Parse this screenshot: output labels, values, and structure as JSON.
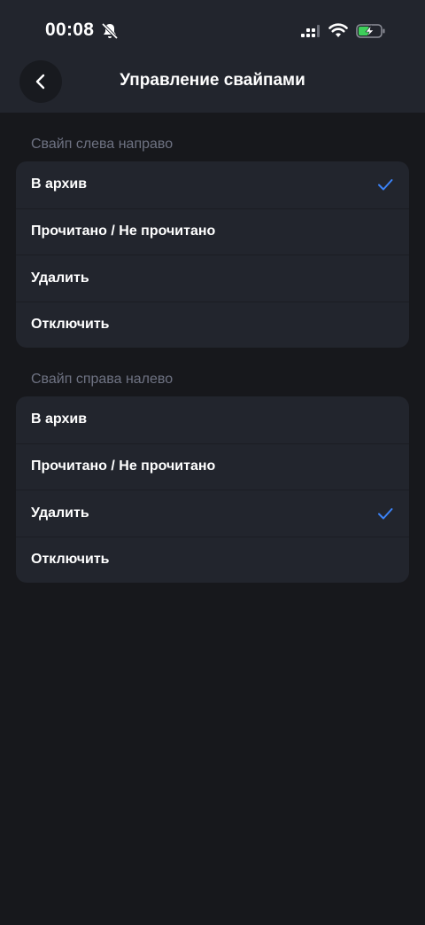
{
  "status_bar": {
    "time": "00:08"
  },
  "header": {
    "title": "Управление свайпами"
  },
  "colors": {
    "accent": "#3b82f6",
    "background": "#17181c",
    "card": "#22252d",
    "section_text": "#6e7282"
  },
  "icons": {
    "back": "chevron-left-icon",
    "check": "checkmark-icon",
    "silent": "bell-off-icon"
  },
  "sections": [
    {
      "title": "Свайп слева направо",
      "options": [
        {
          "label": "В архив",
          "selected": true
        },
        {
          "label": "Прочитано / Не прочитано",
          "selected": false
        },
        {
          "label": "Удалить",
          "selected": false
        },
        {
          "label": "Отключить",
          "selected": false
        }
      ]
    },
    {
      "title": "Свайп справа налево",
      "options": [
        {
          "label": "В архив",
          "selected": false
        },
        {
          "label": "Прочитано / Не прочитано",
          "selected": false
        },
        {
          "label": "Удалить",
          "selected": true
        },
        {
          "label": "Отключить",
          "selected": false
        }
      ]
    }
  ]
}
